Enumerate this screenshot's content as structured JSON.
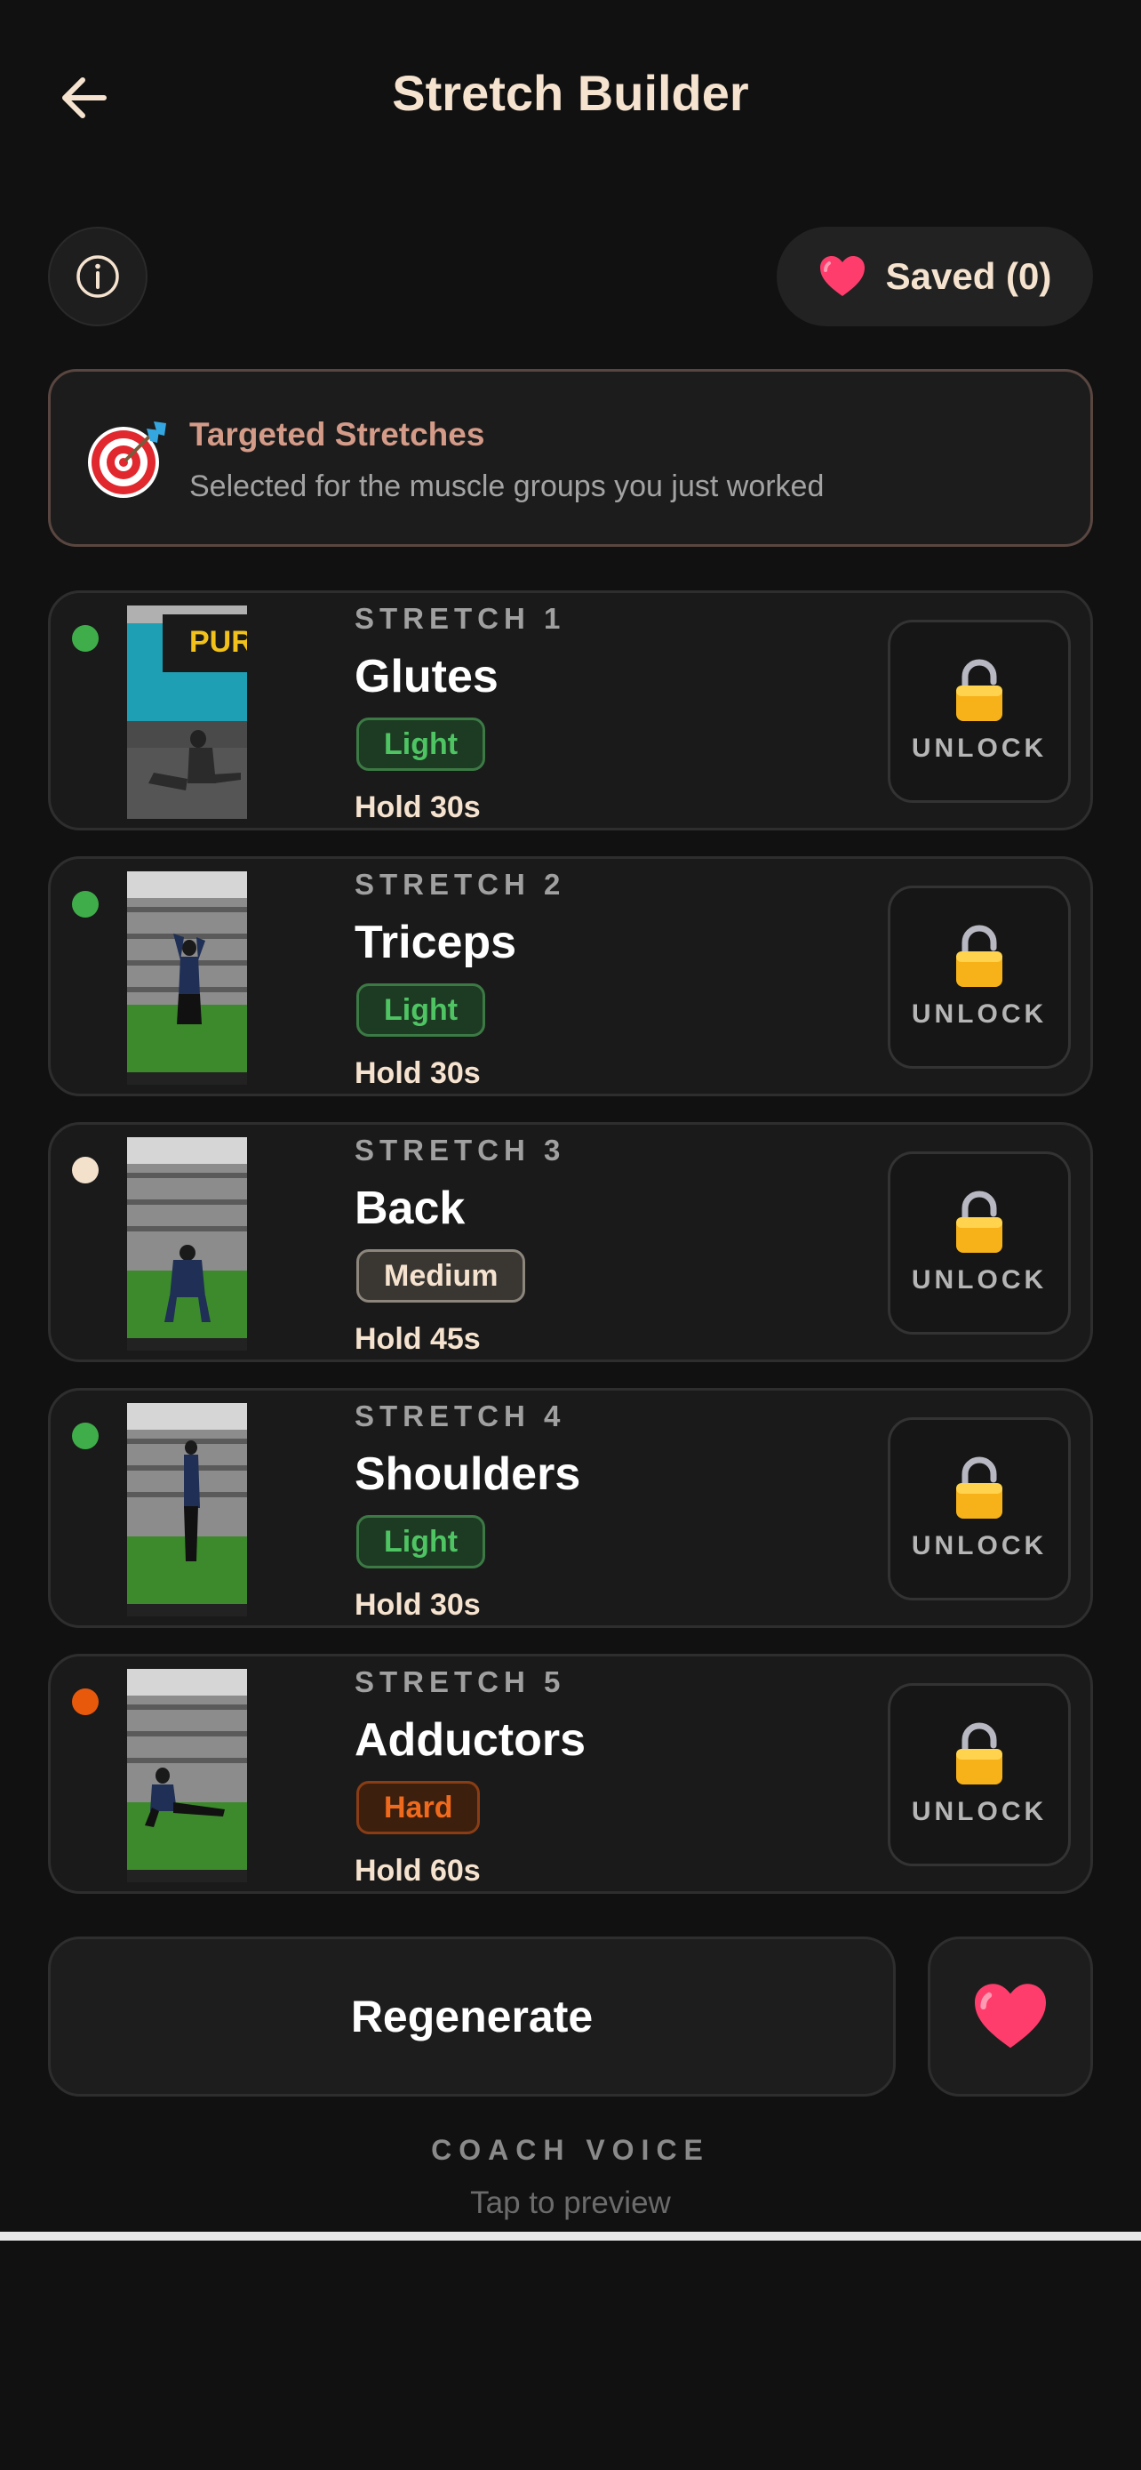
{
  "header": {
    "title": "Stretch Builder",
    "back_icon": "arrow-left-icon"
  },
  "toolbar": {
    "info_icon": "info-icon",
    "saved_label": "Saved (0)",
    "saved_icon": "heart-icon"
  },
  "target": {
    "icon": "target-icon",
    "title": "Targeted Stretches",
    "subtitle": "Selected for the muscle groups you just worked"
  },
  "stretches": [
    {
      "number_label": "STRETCH 1",
      "name": "Glutes",
      "intensity": "Light",
      "hold": "Hold 30s",
      "dot_color": "#3fae4a",
      "lock_icon": "lock-icon",
      "action_label": "UNLOCK"
    },
    {
      "number_label": "STRETCH 2",
      "name": "Triceps",
      "intensity": "Light",
      "hold": "Hold 30s",
      "dot_color": "#3fae4a",
      "lock_icon": "lock-icon",
      "action_label": "UNLOCK"
    },
    {
      "number_label": "STRETCH 3",
      "name": "Back",
      "intensity": "Medium",
      "hold": "Hold 45s",
      "dot_color": "#f3e1cc",
      "lock_icon": "lock-icon",
      "action_label": "UNLOCK"
    },
    {
      "number_label": "STRETCH 4",
      "name": "Shoulders",
      "intensity": "Light",
      "hold": "Hold 30s",
      "dot_color": "#3fae4a",
      "lock_icon": "lock-icon",
      "action_label": "UNLOCK"
    },
    {
      "number_label": "STRETCH 5",
      "name": "Adductors",
      "intensity": "Hard",
      "hold": "Hold 60s",
      "dot_color": "#e8590c",
      "lock_icon": "lock-icon",
      "action_label": "UNLOCK"
    }
  ],
  "footer": {
    "regenerate_label": "Regenerate",
    "favorite_icon": "heart-icon",
    "coach_voice_label": "COACH VOICE",
    "coach_voice_sub": "Tap to preview"
  },
  "colors": {
    "background": "#111111",
    "title": "#f6e3cf",
    "light_badge": "#4ec463",
    "medium_badge": "#f6e3cf",
    "hard_badge": "#ef6a1c",
    "accent_target": "#d49b88"
  }
}
